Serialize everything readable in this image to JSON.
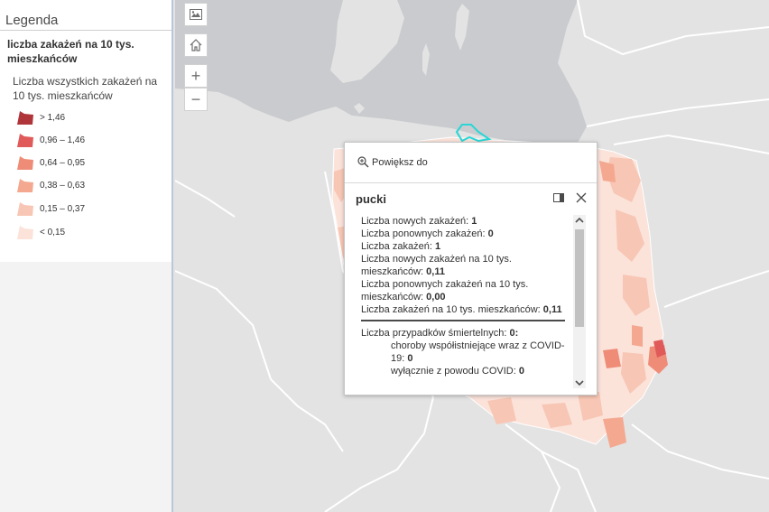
{
  "legend": {
    "title": "Legenda",
    "layer_title": "liczba zakażeń na 10 tys. mieszkańców",
    "field_label": "Liczba wszystkich zakażeń na 10 tys. mieszkańców",
    "classes": [
      {
        "label": "> 1,46",
        "color": "#b0353b"
      },
      {
        "label": "0,96 – 1,46",
        "color": "#e05a5a"
      },
      {
        "label": "0,64 – 0,95",
        "color": "#ef8c78"
      },
      {
        "label": "0,38 – 0,63",
        "color": "#f4a890"
      },
      {
        "label": "0,15 – 0,37",
        "color": "#f8c6b4"
      },
      {
        "label": "< 0,15",
        "color": "#fbe3da"
      }
    ]
  },
  "map_controls": {
    "basemap": "basemap-gallery-icon",
    "home": "home-icon",
    "zoom_in": "+",
    "zoom_out": "−"
  },
  "popup": {
    "zoom_action": "Powiększ do",
    "title": "pucki",
    "fields": [
      {
        "label": "Liczba nowych zakażeń:",
        "value": "1"
      },
      {
        "label": "Liczba ponownych zakażeń:",
        "value": "0"
      },
      {
        "label": "Liczba zakażeń:",
        "value": "1"
      },
      {
        "label": "Liczba nowych zakażeń na 10 tys. mieszkańców:",
        "value": "0,11"
      },
      {
        "label": "Liczba ponownych zakażeń na 10 tys. mieszkańców:",
        "value": "0,00"
      },
      {
        "label": "Liczba zakażeń na 10 tys. mieszkańców:",
        "value": "0,11"
      }
    ],
    "deaths_label": "Liczba przypadków śmiertelnych:",
    "deaths_value": "0:",
    "comorbid_label": "choroby współistniejące wraz z COVID-19:",
    "comorbid_value": "0",
    "covid_only_label": "wyłącznie z powodu COVID:",
    "covid_only_value": "0"
  },
  "colors": {
    "sea": "#c9cbce",
    "land": "#e3e3e3",
    "border": "#ffffff",
    "highlight": "#28d6d6"
  }
}
